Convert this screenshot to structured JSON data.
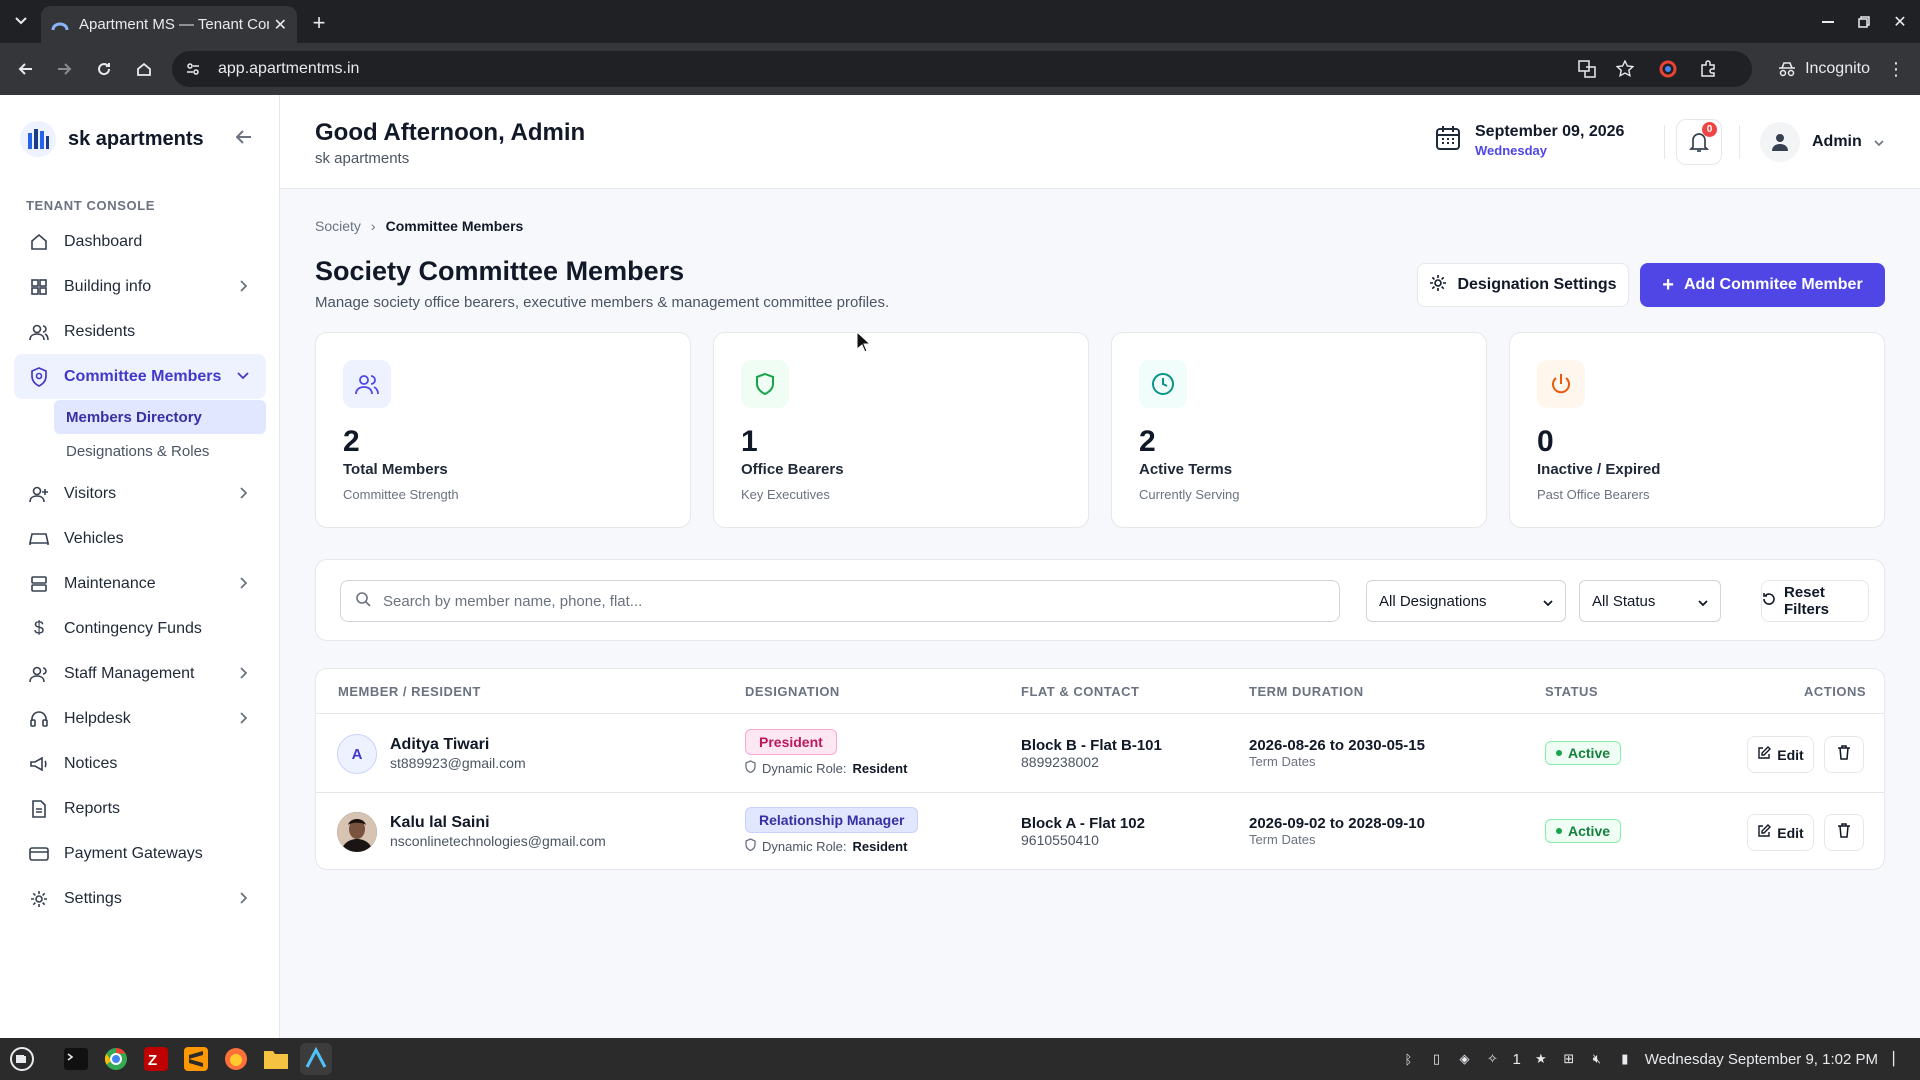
{
  "browser": {
    "tab_title": "Apartment MS — Tenant Console",
    "url": "app.apartmentms.in",
    "incognito_label": "Incognito"
  },
  "sidebar": {
    "brand": "sk apartments",
    "section": "TENANT CONSOLE",
    "items": [
      {
        "label": "Dashboard",
        "icon": "home-icon"
      },
      {
        "label": "Building info",
        "icon": "grid-icon"
      },
      {
        "label": "Residents",
        "icon": "users-icon"
      },
      {
        "label": "Committee Members",
        "icon": "shield-badge-icon"
      },
      {
        "label": "Visitors",
        "icon": "user-plus-icon"
      },
      {
        "label": "Vehicles",
        "icon": "car-icon"
      },
      {
        "label": "Maintenance",
        "icon": "server-icon"
      },
      {
        "label": "Contingency Funds",
        "icon": "dollar-icon"
      },
      {
        "label": "Staff Management",
        "icon": "staff-icon"
      },
      {
        "label": "Helpdesk",
        "icon": "headset-icon"
      },
      {
        "label": "Notices",
        "icon": "megaphone-icon"
      },
      {
        "label": "Reports",
        "icon": "report-icon"
      },
      {
        "label": "Payment Gateways",
        "icon": "card-icon"
      },
      {
        "label": "Settings",
        "icon": "gear-icon"
      }
    ],
    "subitems": [
      "Members Directory",
      "Designations & Roles"
    ]
  },
  "header": {
    "greeting": "Good Afternoon, Admin",
    "subtitle": "sk apartments",
    "date": "September 09, 2026",
    "weekday": "Wednesday",
    "notifications": "0",
    "user": "Admin"
  },
  "page": {
    "breadcrumb": [
      "Society",
      "Committee Members"
    ],
    "title": "Society Committee Members",
    "subtitle": "Manage society office bearers, executive members & management committee profiles.",
    "btn_settings": "Designation Settings",
    "btn_add": "Add Commitee Member"
  },
  "stats": [
    {
      "value": "2",
      "label": "Total Members",
      "sub": "Committee Strength",
      "color": "#4f46e5"
    },
    {
      "value": "1",
      "label": "Office Bearers",
      "sub": "Key Executives",
      "color": "#16a34a"
    },
    {
      "value": "2",
      "label": "Active Terms",
      "sub": "Currently Serving",
      "color": "#0d9488"
    },
    {
      "value": "0",
      "label": "Inactive / Expired",
      "sub": "Past Office Bearers",
      "color": "#ea580c"
    }
  ],
  "filters": {
    "search_placeholder": "Search by member name, phone, flat...",
    "designation": "All Designations",
    "status": "All Status",
    "reset": "Reset Filters"
  },
  "table": {
    "headers": [
      "MEMBER / RESIDENT",
      "DESIGNATION",
      "FLAT & CONTACT",
      "TERM DURATION",
      "STATUS",
      "ACTIONS"
    ],
    "dynamic_role_label": "Dynamic Role:",
    "term_sub": "Term Dates",
    "edit_label": "Edit",
    "rows": [
      {
        "initial": "A",
        "name": "Aditya Tiwari",
        "email": "st889923@gmail.com",
        "designation": "President",
        "role": "Resident",
        "flat": "Block B - Flat B-101",
        "phone": "8899238002",
        "term": "2026-08-26 to 2030-05-15",
        "status": "Active"
      },
      {
        "initial": "",
        "name": "Kalu lal Saini",
        "email": "nsconlinetechnologies@gmail.com",
        "designation": "Relationship Manager",
        "role": "Resident",
        "flat": "Block A - Flat 102",
        "phone": "9610550410",
        "term": "2026-09-02 to 2028-09-10",
        "status": "Active"
      }
    ]
  },
  "taskbar": {
    "clock": "Wednesday September 9, 1:02 PM",
    "badge": "1"
  }
}
